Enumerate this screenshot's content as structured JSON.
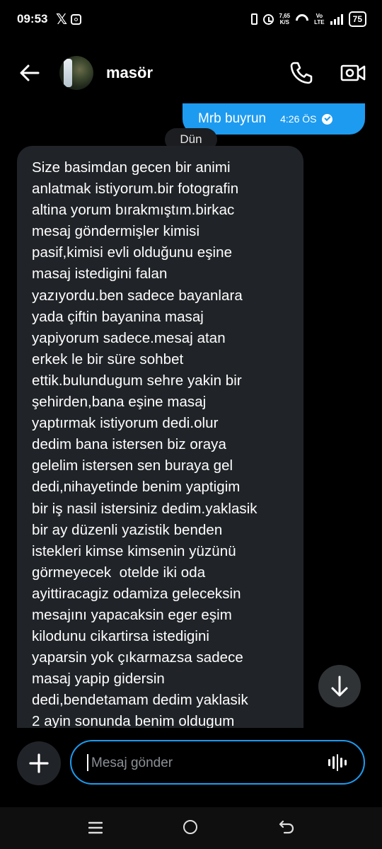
{
  "status_bar": {
    "time": "09:53",
    "x_logo": "𝕏",
    "net_speed_value": "7,65",
    "net_speed_unit": "K/S",
    "network_top": "Vo",
    "network_bottom": "LTE",
    "battery": "75"
  },
  "header": {
    "contact_name": "masör",
    "icons": [
      "back-arrow-icon",
      "avatar",
      "phone-icon",
      "video-call-icon"
    ]
  },
  "conversation": {
    "sent_message": {
      "text": "Mrb buyrun",
      "time": "4:26 ÖS",
      "status": "seen"
    },
    "date_separator": "Dün",
    "received_message": {
      "text": "Size basimdan gecen bir animi\nanlatmak istiyorum.bir fotografin\naltina yorum bırakmıştım.birkac\nmesaj göndermişler kimisi\npasif,kimisi evli olduğunu eşine\nmasaj istedigini falan\nyazıyordu.ben sadece bayanlara\nyada çiftin bayanina masaj\nyapiyorum sadece.mesaj atan\nerkek le bir süre sohbet\nettik.bulundugum sehre yakin bir\nşehirden,bana eşine masaj\nyaptırmak istiyorum dedi.olur\ndedim bana istersen biz oraya\ngelelim istersen sen buraya gel\ndedi,nihayetinde benim yaptigim\nbir iş nasil istersiniz dedim.yaklasik\nbir ay düzenli yazistik benden\nistekleri kimse kimsenin yüzünü\ngörmeyecek  otelde iki oda\nayittiracagiz odamiza geleceksin\nmesajını yapacaksin eger eşim\nkilodunu cikartirsa istedigini\nyaparsin yok çıkarmazsa sadece\nmasaj yapip gidersin\ndedi,bendetamam dedim yaklasik\n2 ayin sonunda benim oldugum"
    }
  },
  "composer": {
    "placeholder": "Mesaj gönder",
    "value": ""
  },
  "colors": {
    "accent": "#1d9bf0",
    "background": "#000000",
    "received_bubble": "#202327"
  }
}
